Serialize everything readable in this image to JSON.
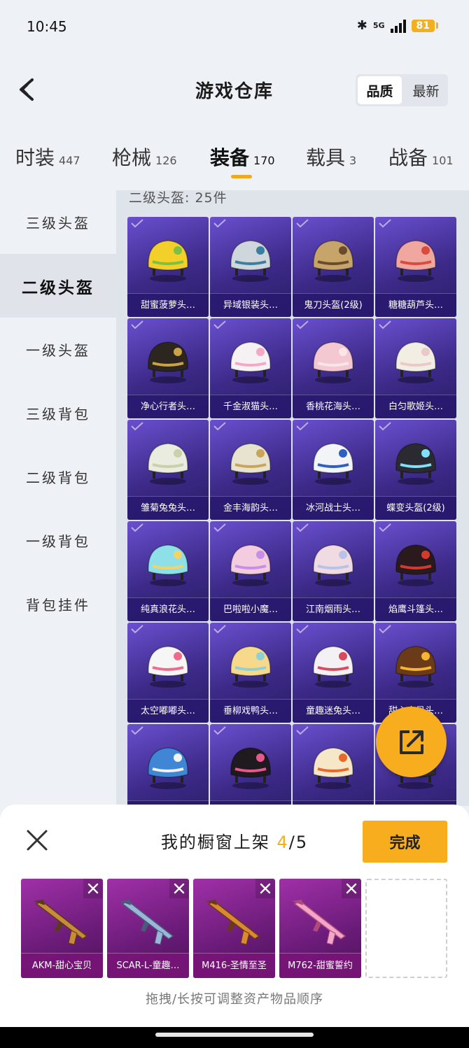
{
  "status_bar": {
    "time": "10:45",
    "battery": "81",
    "network": "5G"
  },
  "header": {
    "title": "游戏仓库",
    "sort_options": [
      "品质",
      "最新"
    ],
    "sort_selected": "品质"
  },
  "tabs": [
    {
      "label": "时装",
      "count": "447"
    },
    {
      "label": "枪械",
      "count": "126"
    },
    {
      "label": "装备",
      "count": "170",
      "active": true
    },
    {
      "label": "载具",
      "count": "3"
    },
    {
      "label": "战备",
      "count": "101"
    }
  ],
  "sidebar": [
    {
      "label": "三级头盔"
    },
    {
      "label": "二级头盔",
      "active": true
    },
    {
      "label": "一级头盔"
    },
    {
      "label": "三级背包"
    },
    {
      "label": "二级背包"
    },
    {
      "label": "一级背包"
    },
    {
      "label": "背包挂件"
    }
  ],
  "section_label": "二级头盔: 25件",
  "items": [
    {
      "name": "甜蜜菠萝头…",
      "colors": [
        "#f3cf2a",
        "#7cc142"
      ]
    },
    {
      "name": "异域银装头…",
      "colors": [
        "#cfd6dc",
        "#3a7ea0"
      ]
    },
    {
      "name": "鬼刀头盔(2级)",
      "colors": [
        "#c7a56a",
        "#6b4b2a"
      ]
    },
    {
      "name": "糖糖葫芦头…",
      "colors": [
        "#f0a7a0",
        "#d94b3c"
      ]
    },
    {
      "name": "净心行者头…",
      "colors": [
        "#2d261f",
        "#caa247"
      ]
    },
    {
      "name": "千金淑猫头…",
      "colors": [
        "#f6f2f4",
        "#f1a9c6"
      ]
    },
    {
      "name": "香桃花海头…",
      "colors": [
        "#f4c8d0",
        "#f8e6ea"
      ]
    },
    {
      "name": "白匀歌姬头…",
      "colors": [
        "#f3eee4",
        "#e9c9c9"
      ]
    },
    {
      "name": "雏菊兔兔头…",
      "colors": [
        "#e9ecdf",
        "#c8d1a8"
      ]
    },
    {
      "name": "金丰海韵头…",
      "colors": [
        "#e8e3cf",
        "#c9a55a"
      ]
    },
    {
      "name": "冰河战士头…",
      "colors": [
        "#f2f4f8",
        "#2f5fc2"
      ]
    },
    {
      "name": "蝶变头盔(2级)",
      "colors": [
        "#2a2a30",
        "#7fe0ff"
      ]
    },
    {
      "name": "纯真浪花头…",
      "colors": [
        "#8ee0e8",
        "#f2d36a"
      ]
    },
    {
      "name": "巴啦啦小魔…",
      "colors": [
        "#f4cce0",
        "#c58fe8"
      ]
    },
    {
      "name": "江南烟雨头…",
      "colors": [
        "#f1dbe3",
        "#b9c2e8"
      ]
    },
    {
      "name": "焰鹰斗篷头…",
      "colors": [
        "#2a1a1e",
        "#d63a2c"
      ]
    },
    {
      "name": "太空嘟嘟头…",
      "colors": [
        "#f6f6f6",
        "#ef6b8c"
      ]
    },
    {
      "name": "垂柳戏鸭头…",
      "colors": [
        "#f6d98a",
        "#8fd0d6"
      ]
    },
    {
      "name": "童趣迷兔头…",
      "colors": [
        "#f4f1f4",
        "#d84a5e"
      ]
    },
    {
      "name": "甜心宝贝头…",
      "colors": [
        "#6b3a18",
        "#f3b532"
      ]
    },
    {
      "name": "",
      "colors": [
        "#3f87d6",
        "#f2f2f2"
      ]
    },
    {
      "name": "",
      "colors": [
        "#1e1a1e",
        "#e45a8c"
      ]
    },
    {
      "name": "",
      "colors": [
        "#f6e7c8",
        "#e86a2a"
      ]
    },
    {
      "name": "",
      "colors": [
        "#333333",
        "#555555"
      ]
    }
  ],
  "showcase": {
    "title": "我的橱窗上架",
    "current": "4",
    "total": "/5",
    "done_label": "完成",
    "slots": [
      {
        "name": "AKM-甜心宝贝",
        "colors": [
          "#c98a3a",
          "#5a3a1c"
        ]
      },
      {
        "name": "SCAR-L-童趣…",
        "colors": [
          "#9ab7d8",
          "#4a5a7a"
        ]
      },
      {
        "name": "M416-圣情至圣",
        "colors": [
          "#d9892e",
          "#6a3a18"
        ]
      },
      {
        "name": "M762-甜蜜誓约",
        "colors": [
          "#f2a6c8",
          "#b04a7a"
        ]
      }
    ],
    "hint": "拖拽/长按可调整资产物品顺序"
  }
}
